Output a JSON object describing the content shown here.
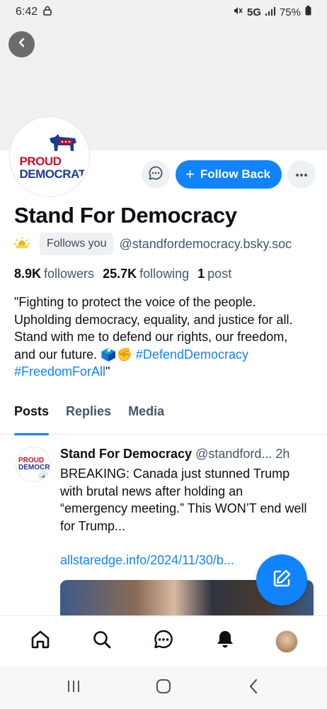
{
  "status_bar": {
    "time": "6:42",
    "network": "5G",
    "battery": "75%"
  },
  "profile": {
    "avatar_text_line1": "PROUD",
    "avatar_text_line2": "DEMOCRAT",
    "display_name": "Stand For Democracy",
    "follows_you_label": "Follows you",
    "handle": "@standfordemocracy.bsky.soc",
    "followers_count": "8.9K",
    "followers_label": "followers",
    "following_count": "25.7K",
    "following_label": "following",
    "posts_count": "1",
    "posts_label": "post",
    "bio_text": "\"Fighting to protect the voice of the people. Upholding democracy, equality, and justice for all. Stand with me to defend our rights, our freedom, and our future. 🗳️✊",
    "bio_hashtags": "#DefendDemocracy #FreedomForAll",
    "bio_end": "\""
  },
  "actions": {
    "follow_back_label": "Follow Back"
  },
  "tabs": [
    {
      "label": "Posts",
      "active": true
    },
    {
      "label": "Replies",
      "active": false
    },
    {
      "label": "Media",
      "active": false
    }
  ],
  "post": {
    "author_name": "Stand For Democracy",
    "author_handle": "@standford...",
    "age": "2h",
    "text": "BREAKING: Canada just stunned Trump with brutal news after holding an “emergency meeting.” This WON’T end well for Trump...",
    "link": "allstaredge.info/2024/11/30/b..."
  },
  "colors": {
    "accent": "#1083fe",
    "text_primary": "#0b0f14",
    "text_secondary": "#42576c"
  }
}
